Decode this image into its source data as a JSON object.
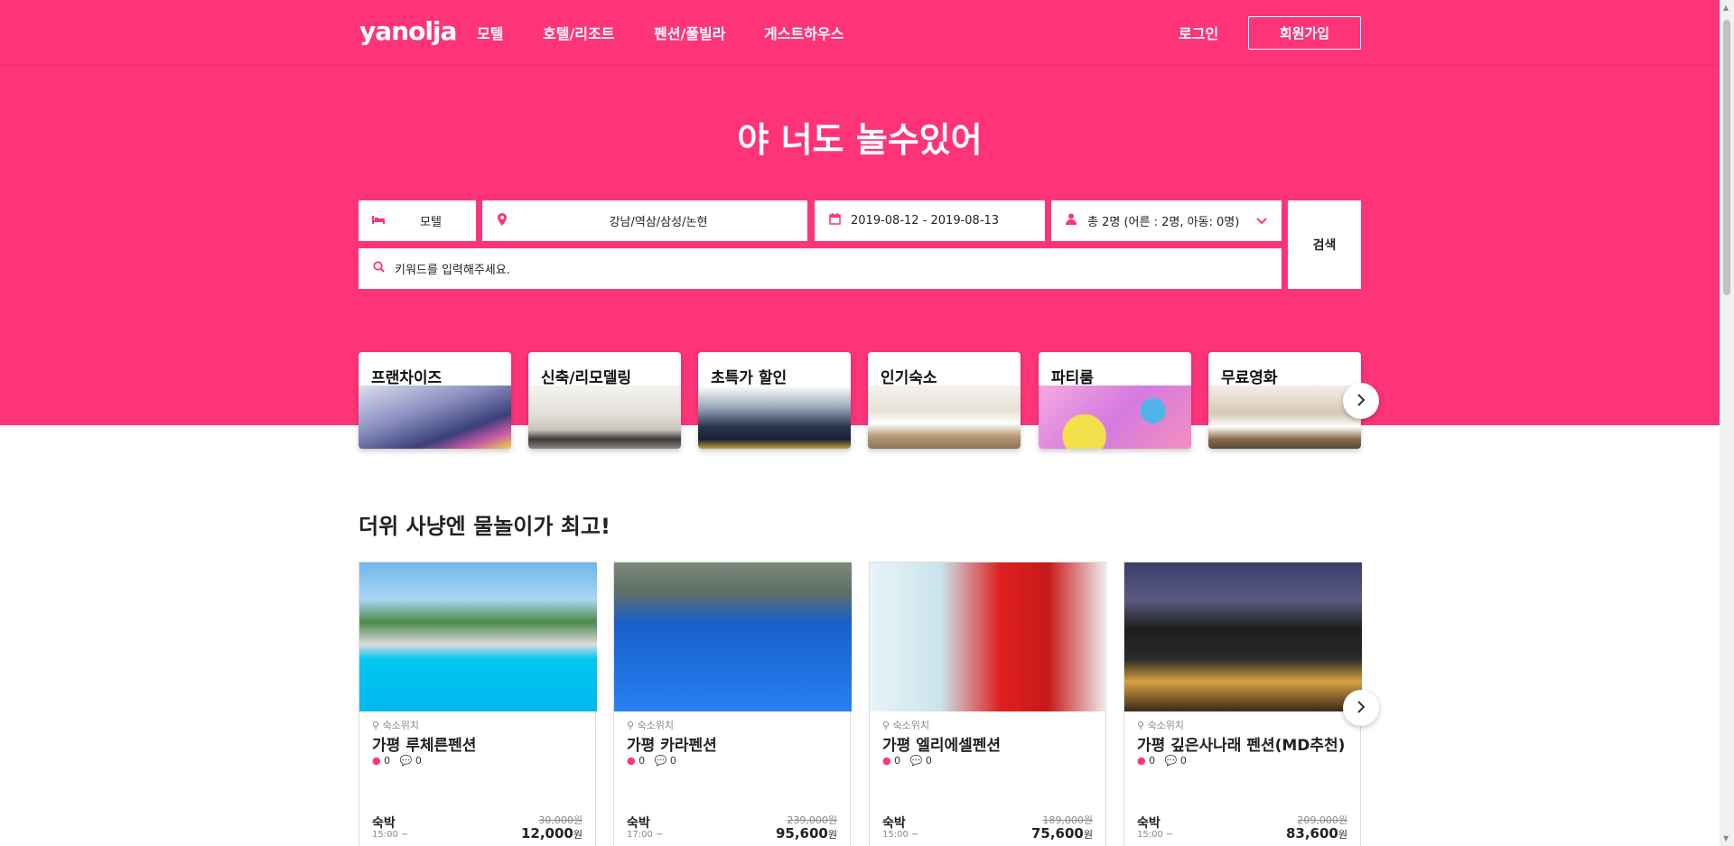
{
  "header": {
    "logo": "yanolja",
    "nav": [
      "모텔",
      "호텔/리조트",
      "펜션/풀빌라",
      "게스트하우스"
    ],
    "login": "로그인",
    "signup": "회원가입"
  },
  "hero": {
    "headline": "야 너도 놀수있어"
  },
  "search": {
    "type_icon": "bed-icon",
    "type_value": "모텔",
    "location_icon": "location-pin-icon",
    "location_value": "강남/역삼/삼성/논현",
    "date_icon": "calendar-icon",
    "date_value": "2019-08-12 - 2019-08-13",
    "guests_icon": "person-icon",
    "guests_value": "총 2명 (어른 : 2명, 아동: 0명)",
    "keyword_icon": "search-icon",
    "keyword_placeholder": "키워드를 입력해주세요.",
    "search_button": "검색"
  },
  "categories": [
    {
      "label": "프랜차이즈"
    },
    {
      "label": "신축/리모델링"
    },
    {
      "label": "초특가 할인"
    },
    {
      "label": "인기숙소"
    },
    {
      "label": "파티룸"
    },
    {
      "label": "무료영화"
    }
  ],
  "section": {
    "title": "더위 사냥엔 물놀이가 최고!"
  },
  "listings": [
    {
      "loc": "숙소위치",
      "name": "가평 루체른펜션",
      "likes": "0",
      "comments": "0",
      "stay": "숙박",
      "time": "15:00 ~",
      "orig": "30,000원",
      "price": "12,000",
      "unit": "원"
    },
    {
      "loc": "숙소위치",
      "name": "가평 카라펜션",
      "likes": "0",
      "comments": "0",
      "stay": "숙박",
      "time": "17:00 ~",
      "orig": "239,000원",
      "price": "95,600",
      "unit": "원"
    },
    {
      "loc": "숙소위치",
      "name": "가평 엘리에셀펜션",
      "likes": "0",
      "comments": "0",
      "stay": "숙박",
      "time": "15:00 ~",
      "orig": "189,000원",
      "price": "75,600",
      "unit": "원"
    },
    {
      "loc": "숙소위치",
      "name": "가평 깊은사나래 펜션(MD추천)",
      "likes": "0",
      "comments": "0",
      "stay": "숙박",
      "time": "15:00 ~",
      "orig": "209,000원",
      "price": "83,600",
      "unit": "원"
    }
  ],
  "colors": {
    "brand": "#ff3478"
  }
}
